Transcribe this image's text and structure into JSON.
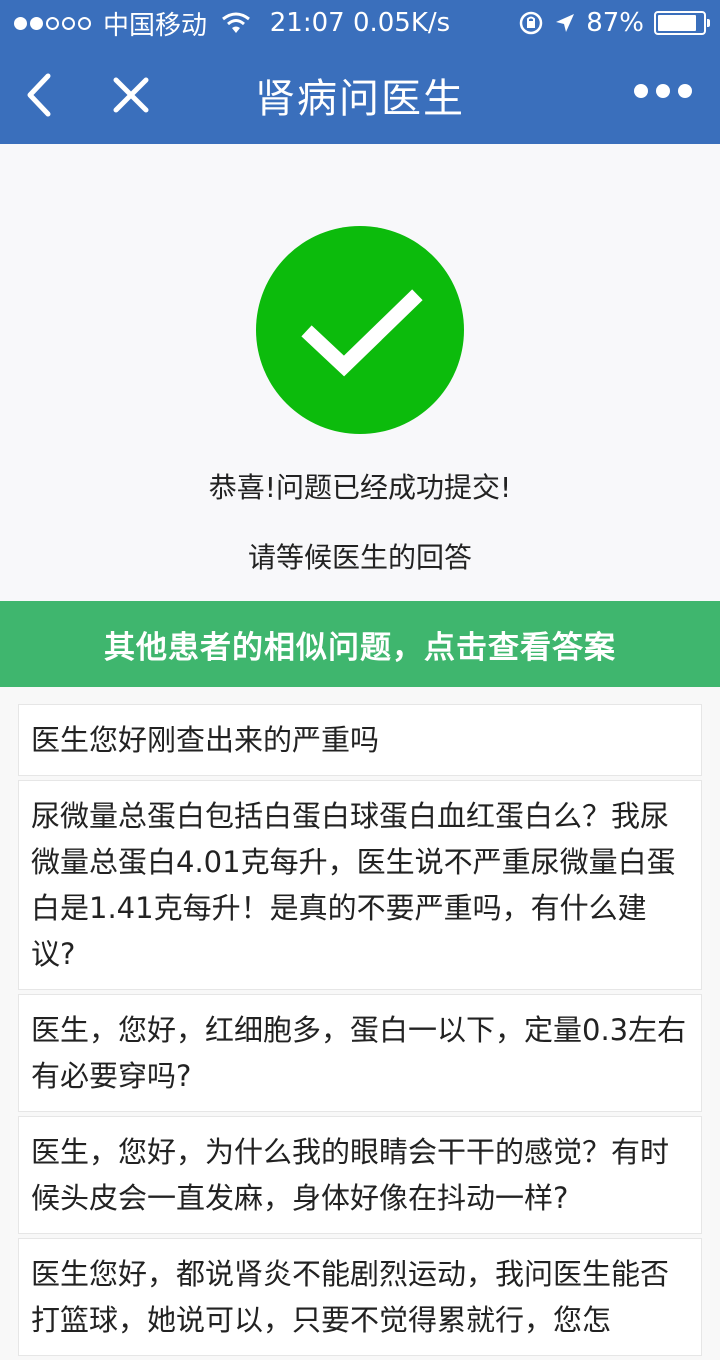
{
  "status_bar": {
    "carrier": "中国移动",
    "time_speed": "21:07 0.05K/s",
    "battery_percent": "87%",
    "battery_level": 0.87
  },
  "nav": {
    "title": "肾病问医生"
  },
  "success": {
    "message_primary": "恭喜!问题已经成功提交!",
    "message_secondary": "请等候医生的回答",
    "accent_color": "#0cbb0c"
  },
  "banner": {
    "text": "其他患者的相似问题，点击查看答案",
    "color": "#3fb66e"
  },
  "questions": [
    "医生您好刚查出来的严重吗",
    "尿微量总蛋白包括白蛋白球蛋白血红蛋白么？我尿微量总蛋白4.01克每升，医生说不严重尿微量白蛋白是1.41克每升！是真的不要严重吗，有什么建议?",
    "医生，您好，红细胞多，蛋白一以下，定量0.3左右有必要穿吗?",
    "医生，您好，为什么我的眼睛会干干的感觉？有时候头皮会一直发麻，身体好像在抖动一样?",
    "医生您好，都说肾炎不能剧烈运动，我问医生能否打篮球，她说可以，只要不觉得累就行，您怎"
  ],
  "theme": {
    "header_color": "#3a6fbc"
  }
}
